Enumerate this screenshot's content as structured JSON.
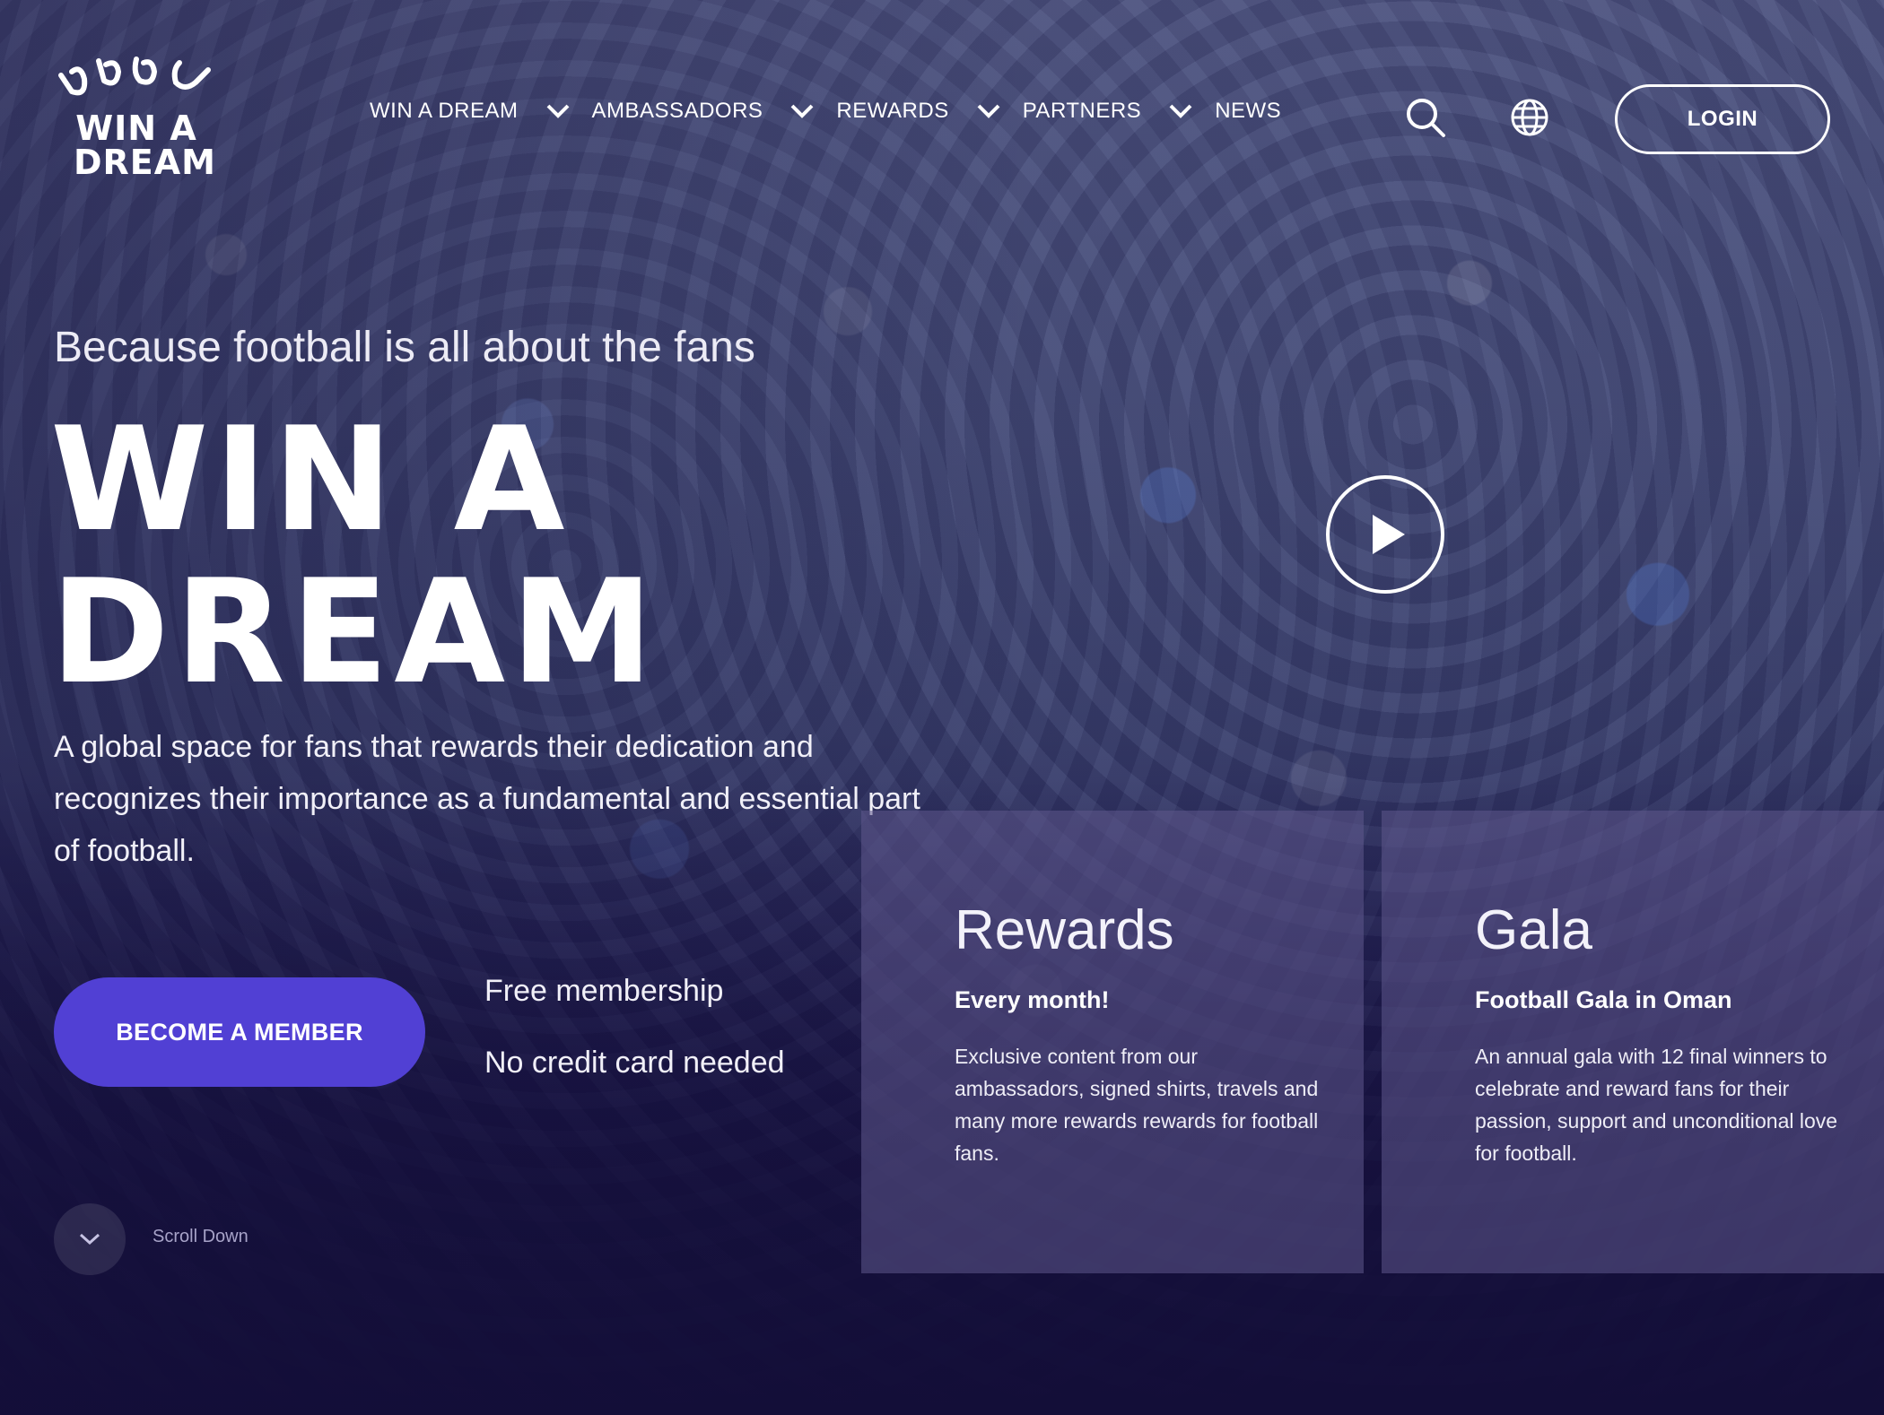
{
  "brand": {
    "logo_text": "WIN A DREAM"
  },
  "nav": {
    "items": [
      {
        "label": "WIN A DREAM",
        "has_dropdown": true
      },
      {
        "label": "AMBASSADORS",
        "has_dropdown": true
      },
      {
        "label": "REWARDS",
        "has_dropdown": true
      },
      {
        "label": "PARTNERS",
        "has_dropdown": true
      },
      {
        "label": "NEWS",
        "has_dropdown": false
      }
    ],
    "search_icon": "search-icon",
    "language_icon": "globe-icon",
    "login_label": "LOGIN"
  },
  "hero": {
    "tagline": "Because football is all about the fans",
    "title_line1": "WIN A",
    "title_line2": "DREAM",
    "description": "A global space for fans that rewards their dedication and recognizes their importance as a fundamental and essential part of football.",
    "cta_label": "BECOME A MEMBER",
    "perk_1": "Free membership",
    "perk_2": "No credit card needed",
    "scroll_label": "Scroll Down",
    "play_icon": "play-icon"
  },
  "cards": [
    {
      "title": "Rewards",
      "subtitle": "Every month!",
      "body": "Exclusive content from our ambassadors, signed shirts, travels and many more rewards rewards for football fans."
    },
    {
      "title": "Gala",
      "subtitle": "Football Gala in Oman",
      "body": "An annual gala with 12 final winners to celebrate and reward fans for their passion, support and unconditional love for football."
    }
  ],
  "colors": {
    "cta_background": "#5140d4",
    "page_background": "#140f3a",
    "card_background": "rgba(95,88,140,0.55)"
  }
}
